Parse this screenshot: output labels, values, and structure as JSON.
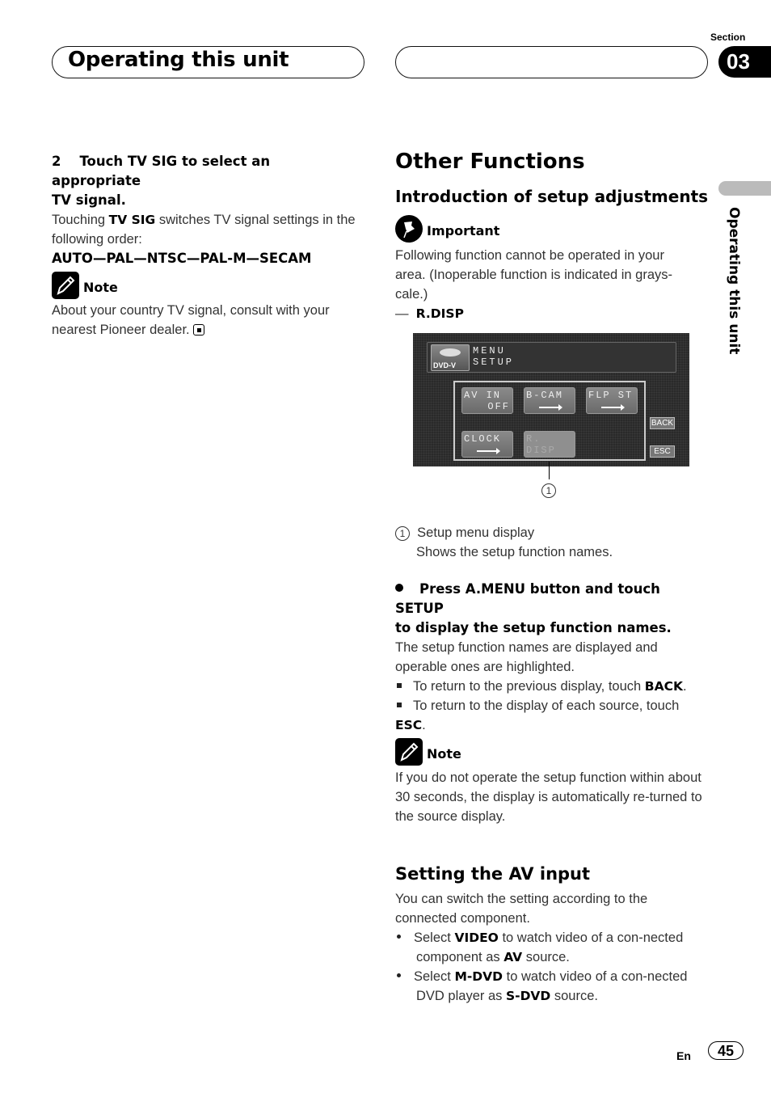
{
  "header": {
    "title": "Operating this unit",
    "section_label": "Section",
    "section_number": "03",
    "side_tab_text": "Operating this unit"
  },
  "left": {
    "step": {
      "number": "2",
      "heading_line1": "Touch TV SIG to select an appropriate",
      "heading_line2": "TV signal.",
      "text_pre": "Touching ",
      "text_bold": "TV SIG",
      "text_post": " switches TV signal settings in the following order:",
      "order": "AUTO—PAL—NTSC—PAL-M—SECAM"
    },
    "note": {
      "label": "Note",
      "text": "About your country TV signal, consult with your nearest Pioneer dealer."
    }
  },
  "right": {
    "title": "Other Functions",
    "subtitle": "Introduction of setup adjustments",
    "important": {
      "label": "Important",
      "text": "Following function cannot be operated in your area. (Inoperable function is indicated in grays-cale.)",
      "item_dash": "—",
      "item": "R.DISP"
    },
    "screen": {
      "logo_text": "DVD-V",
      "menu_line1": "MENU",
      "menu_line2": "SETUP",
      "buttons": [
        {
          "label": "AV IN",
          "value": "OFF",
          "enabled": true
        },
        {
          "label": "B-CAM",
          "value": "→",
          "enabled": true
        },
        {
          "label": "FLP ST",
          "value": "→",
          "enabled": true
        },
        {
          "label": "CLOCK",
          "value": "→",
          "enabled": true
        },
        {
          "label": "R. DISP",
          "value": "",
          "enabled": false
        }
      ],
      "back": "BACK",
      "esc": "ESC",
      "callout": "1"
    },
    "legend": {
      "number": "1",
      "title": "Setup menu display",
      "desc": "Shows the setup function names."
    },
    "instruction": {
      "heading_line1": "Press A.MENU button and touch SETUP",
      "heading_line2": "to display the setup function names.",
      "text": "The setup function names are displayed and operable ones are highlighted.",
      "bullets": [
        {
          "pre": "To return to the previous display, touch ",
          "bold": "BACK",
          "post": "."
        },
        {
          "pre": "To return to the display of each source, touch ",
          "bold": "ESC",
          "post": "."
        }
      ]
    },
    "note": {
      "label": "Note",
      "text": "If you do not operate the setup function within about 30 seconds, the display is automatically re-turned to the source display."
    },
    "av_input": {
      "title": "Setting the AV input",
      "intro": "You can switch the setting according to the connected component.",
      "bullets": [
        {
          "pre": "Select ",
          "b1": "VIDEO",
          "mid": " to watch video of a con-nected component as ",
          "b2": "AV",
          "post": " source."
        },
        {
          "pre": "Select ",
          "b1": "M-DVD",
          "mid": " to watch video of a con-nected DVD player as ",
          "b2": "S-DVD",
          "post": " source."
        }
      ]
    }
  },
  "footer": {
    "lang": "En",
    "page": "45"
  }
}
